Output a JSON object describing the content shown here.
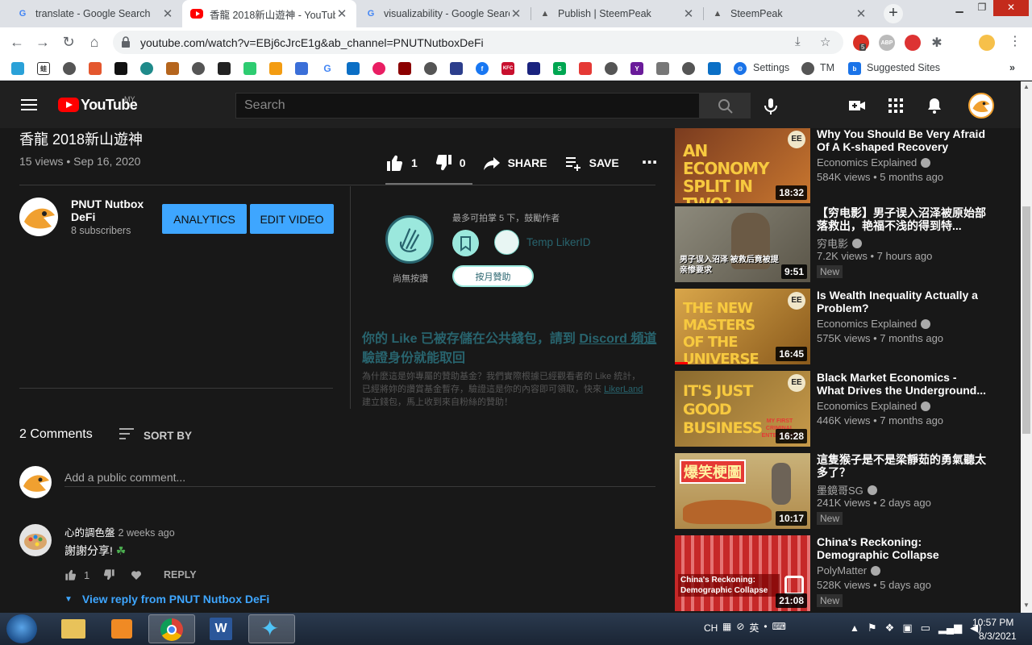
{
  "browser": {
    "tabs": [
      {
        "title": "translate - Google Search",
        "icon": "google-icon",
        "active": false
      },
      {
        "title": "香龍 2018新山遊神 - YouTube",
        "icon": "youtube-icon",
        "active": true
      },
      {
        "title": "visualizability - Google Search",
        "icon": "google-icon",
        "active": false
      },
      {
        "title": "Publish | SteemPeak",
        "icon": "steempeak-icon",
        "active": false
      },
      {
        "title": "SteemPeak",
        "icon": "steempeak-icon",
        "active": false
      }
    ],
    "url": "youtube.com/watch?v=EBj6cJrcE1g&ab_channel=PNUTNutboxDeFi",
    "extension_badge": "5",
    "extension_abp": "ABP",
    "bookmarks": {
      "settings": "Settings",
      "tm": "TM",
      "suggested": "Suggested Sites"
    }
  },
  "youtube": {
    "logo_text": "YouTube",
    "country": "MY",
    "search_placeholder": "Search",
    "video": {
      "title": "香龍 2018新山遊神",
      "meta": "15 views • Sep 16, 2020",
      "likes": "1",
      "dislikes": "0",
      "share_label": "SHARE",
      "save_label": "SAVE"
    },
    "channel": {
      "name": "PNUT Nutbox DeFi",
      "subscribers": "8 subscribers",
      "analytics_label": "ANALYTICS",
      "edit_label": "EDIT VIDEO"
    },
    "likecoin": {
      "note": "最多可拍掌 5 下，鼓勵作者",
      "clap_label": "尚無按讚",
      "likerid": "Temp LikerID",
      "monthly_label": "按月贊助",
      "headline_pre": "你的 Like 已被存儲在公共錢包，請到 ",
      "headline_link": "Discord 頻道",
      "headline_post": "驗證身份就能取回",
      "body_pre": "為什麼這是妳專屬的贊助基金？我們實際根據已經觀看者的 Like 統計，已經將妳的讚賞基金暫存，驗證這是你的內容即可領取，快來 ",
      "body_link": "LikerLand",
      "body_post": " 建立錢包，馬上收到來自粉絲的贊助！"
    },
    "comments": {
      "count_label": "2 Comments",
      "sort_label": "SORT BY",
      "add_placeholder": "Add a public comment...",
      "items": [
        {
          "author": "心的調色盤",
          "time": "2 weeks ago",
          "text": "謝謝分享!",
          "likes": "1",
          "reply_label": "REPLY",
          "view_reply": "View reply from PNUT Nutbox DeFi"
        }
      ]
    },
    "recommendations": [
      {
        "title": "Why You Should Be Very Afraid Of A K-shaped Recovery",
        "channel": "Economics Explained",
        "stats": "584K views • 5 months ago",
        "duration": "18:32",
        "thumb_text": "AN ECONOMY SPLIT IN TWO?",
        "new": ""
      },
      {
        "title": "【穷电影】男子误入沼泽被原始部落救出，艳福不浅的得到特...",
        "channel": "穷电影",
        "stats": "7.2K views • 7 hours ago",
        "duration": "9:51",
        "thumb_text": "男子误入沼泽 被救后竟被提亲惨要求",
        "new": "New"
      },
      {
        "title": "Is Wealth Inequality Actually a Problem?",
        "channel": "Economics Explained",
        "stats": "575K views • 7 months ago",
        "duration": "16:45",
        "thumb_text": "THE NEW MASTERS OF THE UNIVERSE",
        "new": ""
      },
      {
        "title": "Black Market Economics - What Drives the Underground...",
        "channel": "Economics Explained",
        "stats": "446K views • 7 months ago",
        "duration": "16:28",
        "thumb_text": "IT'S JUST GOOD BUSINESS",
        "thumb_sub": "MY FIRST CRIMINAL ENTERPRISE",
        "new": ""
      },
      {
        "title": "這隻猴子是不是梁靜茹的勇氣聽太多了？",
        "channel": "墨鏡哥SG",
        "stats": "241K views • 2 days ago",
        "duration": "10:17",
        "thumb_text": "爆笑梗圖",
        "new": "New"
      },
      {
        "title": "China's Reckoning: Demographic Collapse",
        "channel": "PolyMatter",
        "stats": "528K views • 5 days ago",
        "duration": "21:08",
        "thumb_text": "China's Reckoning: Demographic Collapse",
        "new": "New"
      }
    ]
  },
  "taskbar": {
    "lang": "CH",
    "time": "10:57 PM",
    "date": "8/3/2021"
  }
}
